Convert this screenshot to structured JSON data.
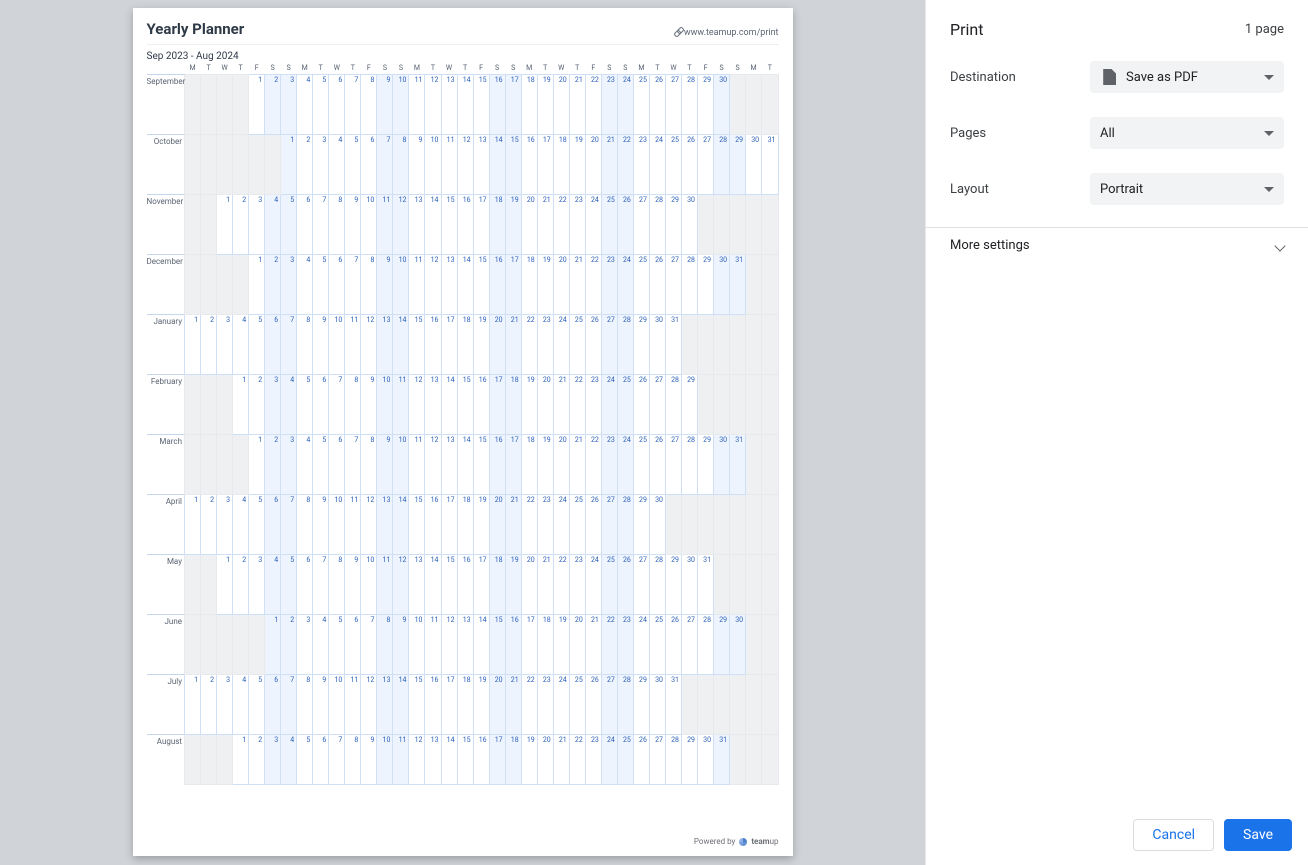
{
  "preview": {
    "title": "Yearly Planner",
    "source_link": "www.teamup.com/print",
    "date_range": "Sep 2023 - Aug 2024",
    "dow": [
      "M",
      "T",
      "W",
      "T",
      "F",
      "S",
      "S"
    ],
    "dow_repeat": 37,
    "months": [
      {
        "label": "September",
        "offset": 4,
        "days": 30
      },
      {
        "label": "October",
        "offset": 6,
        "days": 31
      },
      {
        "label": "November",
        "offset": 2,
        "days": 30
      },
      {
        "label": "December",
        "offset": 4,
        "days": 31
      },
      {
        "label": "January",
        "offset": 0,
        "days": 31
      },
      {
        "label": "February",
        "offset": 3,
        "days": 29
      },
      {
        "label": "March",
        "offset": 4,
        "days": 31
      },
      {
        "label": "April",
        "offset": 0,
        "days": 30
      },
      {
        "label": "May",
        "offset": 2,
        "days": 31
      },
      {
        "label": "June",
        "offset": 5,
        "days": 30
      },
      {
        "label": "July",
        "offset": 0,
        "days": 31
      },
      {
        "label": "August",
        "offset": 3,
        "days": 31
      }
    ],
    "footer_prefix": "Powered by",
    "footer_brand_bold": "team",
    "footer_brand_rest": "up"
  },
  "panel": {
    "title": "Print",
    "sheet_count": "1 page",
    "destination_label": "Destination",
    "destination_value": "Save as PDF",
    "pages_label": "Pages",
    "pages_value": "All",
    "layout_label": "Layout",
    "layout_value": "Portrait",
    "more_label": "More settings",
    "cancel_label": "Cancel",
    "save_label": "Save"
  }
}
